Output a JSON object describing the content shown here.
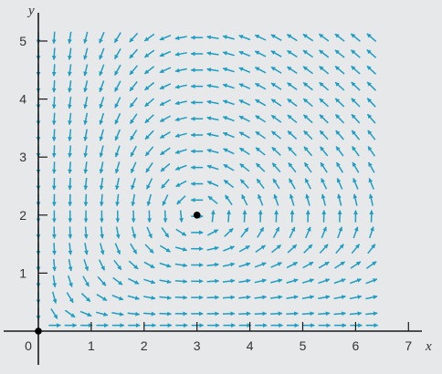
{
  "chart_data": {
    "type": "vector-field",
    "title": "",
    "xlabel": "x",
    "ylabel": "y",
    "xlim": [
      -0.6,
      7.5
    ],
    "ylim": [
      -0.35,
      5.6
    ],
    "xticks": [
      "0",
      "1",
      "2",
      "3",
      "4",
      "5",
      "6",
      "7"
    ],
    "yticks": [
      "1",
      "2",
      "3",
      "4",
      "5"
    ],
    "field": "dx/dt = 0.5x - 0.25xy, dy/dt = -0.75y + 0.25xy",
    "equilibrium_points": [
      {
        "x": 0,
        "y": 0
      },
      {
        "x": 3,
        "y": 2
      }
    ],
    "grid": false,
    "colors": {
      "background": "#e6e8e9",
      "arrows": "#1e9dc2",
      "axes": "#1a1a1a",
      "points": "#000000"
    }
  }
}
